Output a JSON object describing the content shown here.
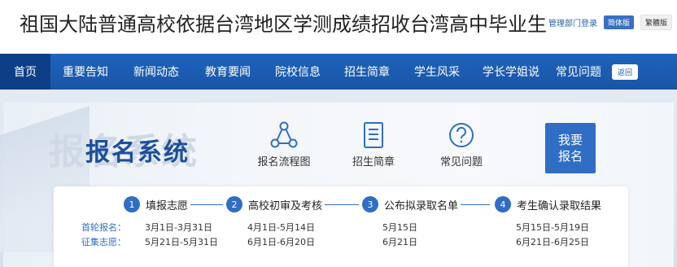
{
  "header": {
    "title": "祖国大陆普通高校依据台湾地区学测成绩招收台湾高中毕业生",
    "admin_login": "管理部门登录",
    "lang_simplified": "简体版",
    "lang_traditional": "繁體版"
  },
  "nav": {
    "items": [
      "首页",
      "重要告知",
      "新闻动态",
      "教育要闻",
      "院校信息",
      "招生简章",
      "学生风采",
      "学长学姐说",
      "常见问题"
    ],
    "back": "返回"
  },
  "hero": {
    "watermark": "报名系统",
    "title": "报名系统",
    "quick_links": [
      {
        "label": "报名流程图",
        "icon": "flow-chart-icon"
      },
      {
        "label": "招生简章",
        "icon": "document-icon"
      },
      {
        "label": "常见问题",
        "icon": "question-icon"
      }
    ],
    "signup_line1": "我要",
    "signup_line2": "报名"
  },
  "steps": {
    "items": [
      {
        "num": "1",
        "label": "填报志愿"
      },
      {
        "num": "2",
        "label": "高校初审及考核"
      },
      {
        "num": "3",
        "label": "公布拟录取名单"
      },
      {
        "num": "4",
        "label": "考生确认录取结果"
      }
    ],
    "rows": [
      {
        "label": "首轮报名：",
        "dates": [
          "3月1日-3月31日",
          "4月1日-5月14日",
          "5月15日",
          "5月15日-5月19日"
        ]
      },
      {
        "label": "征集志愿：",
        "dates": [
          "5月21日-5月31日",
          "6月1日-6月20日",
          "6月21日",
          "6月21日-6月25日"
        ]
      }
    ]
  },
  "colors": {
    "nav_bg": "#1a5bb0",
    "nav_active": "#0d3f87",
    "accent": "#2f6ec4",
    "hero_title": "#1c4f9c"
  }
}
